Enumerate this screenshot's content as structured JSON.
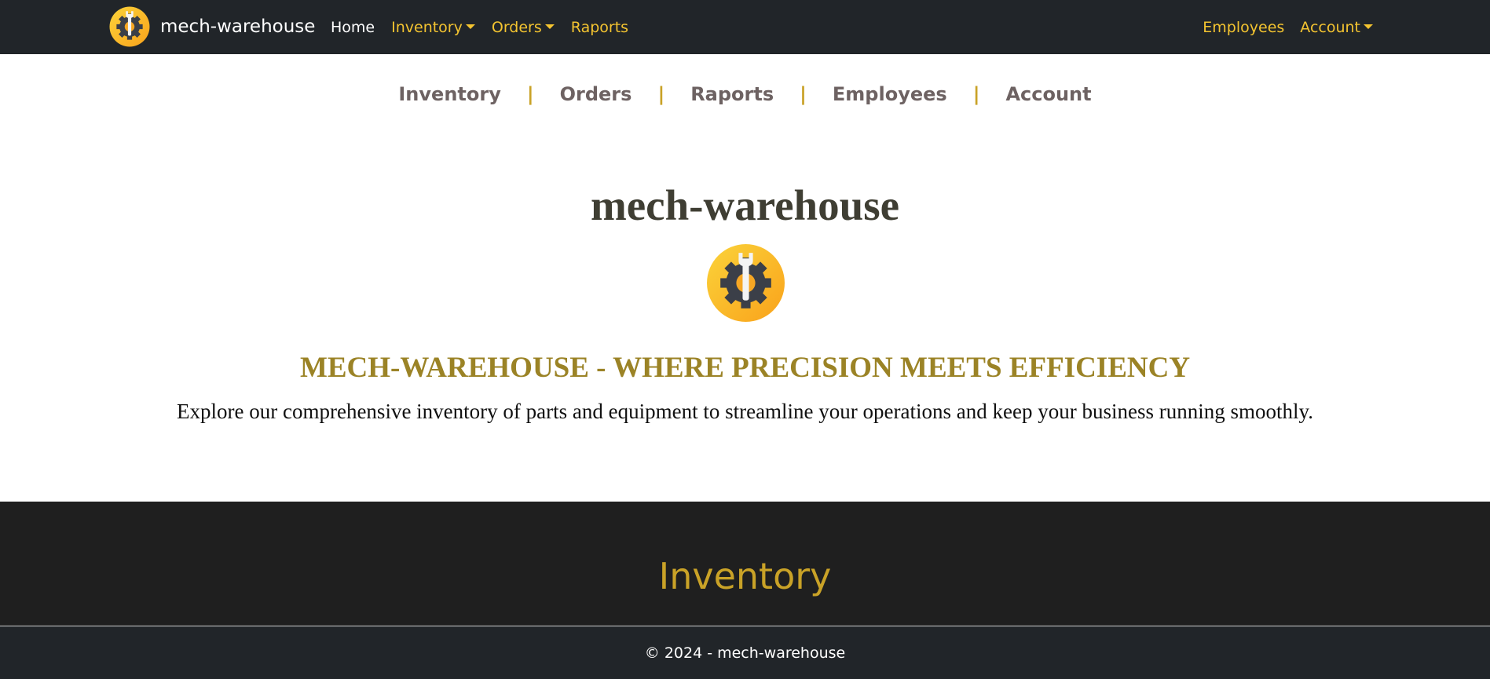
{
  "navbar": {
    "brand": {
      "logo_icon": "gear-wrench-logo-icon",
      "text": "mech-warehouse"
    },
    "left_links": [
      {
        "label": "Home",
        "dropdown": false,
        "active": true
      },
      {
        "label": "Inventory",
        "dropdown": true,
        "active": false
      },
      {
        "label": "Orders",
        "dropdown": true,
        "active": false
      },
      {
        "label": "Raports",
        "dropdown": false,
        "active": false
      }
    ],
    "right_links": [
      {
        "label": "Employees",
        "dropdown": false
      },
      {
        "label": "Account",
        "dropdown": true
      }
    ]
  },
  "subnav": {
    "links": [
      "Inventory",
      "Orders",
      "Raports",
      "Employees",
      "Account"
    ],
    "separator": "|"
  },
  "hero": {
    "title": "mech-warehouse",
    "logo_icon": "gear-wrench-logo-icon",
    "tagline": "MECH-WAREHOUSE - WHERE PRECISION MEETS EFFICIENCY",
    "lead": "Explore our comprehensive inventory of parts and equipment to streamline your operations and keep your business running smoothly."
  },
  "section": {
    "title": "Inventory"
  },
  "footer": {
    "text": "© 2024 - mech-warehouse"
  },
  "colors": {
    "navbar_bg": "#212529",
    "nav_link": "#f4c430",
    "nav_active": "#ffffff",
    "subnav_link": "#6d6262",
    "subnav_separator": "#c9a227",
    "hero_title": "#3f3e33",
    "tagline": "#9b8326",
    "section_bg": "#1f1f1f",
    "section_title": "#c9a227",
    "footer_bg": "#212529"
  }
}
